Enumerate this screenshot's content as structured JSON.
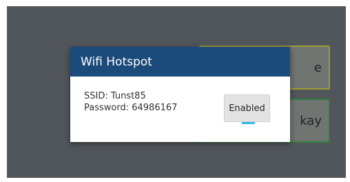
{
  "background": {
    "button_top_label": "e",
    "button_bottom_label": "kay"
  },
  "dialog": {
    "title": "Wifi Hotspot",
    "ssid_text": "SSID: Tunst85",
    "password_text": "Password: 64986167",
    "toggle_label": "Enabled",
    "toggle_state": "on"
  },
  "colors": {
    "header": "#1b4b7a",
    "indicator": "#33b5e5"
  }
}
